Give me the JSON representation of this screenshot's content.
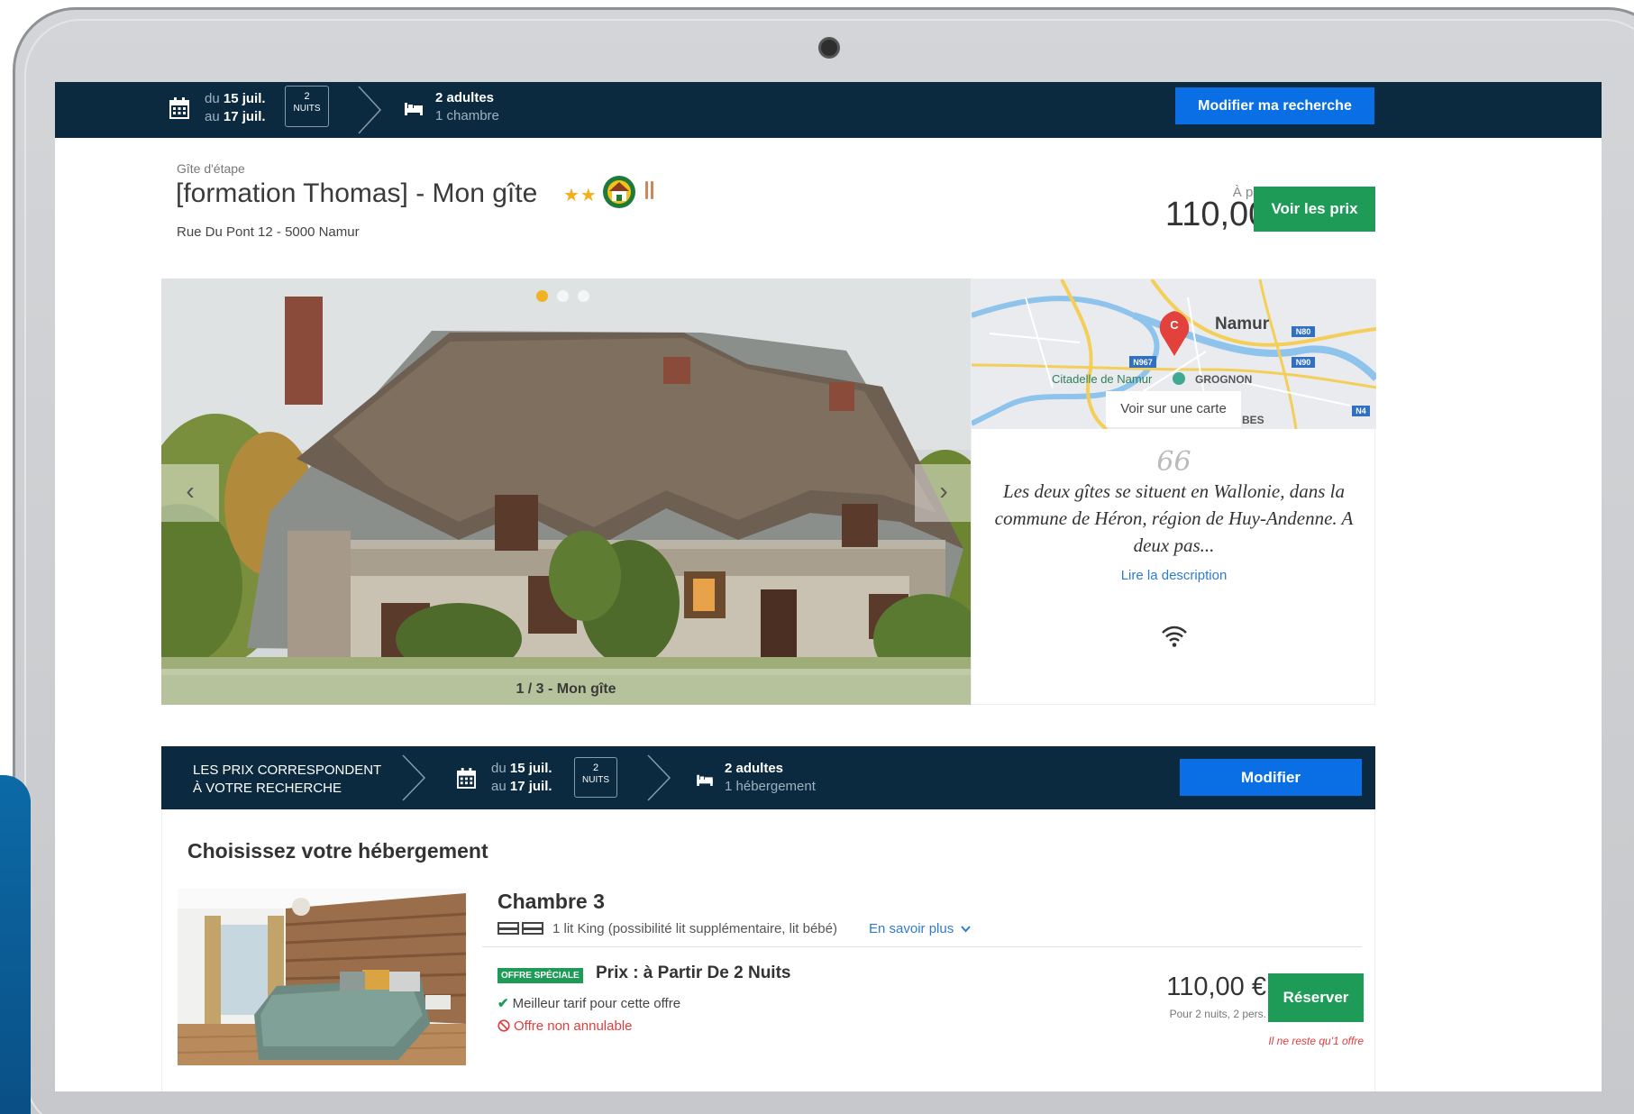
{
  "search_bar": {
    "from_label": "du",
    "from_date": "15 juil.",
    "to_label": "au",
    "to_date": "17 juil.",
    "nights_count": "2",
    "nights_label": "NUITS",
    "guests": "2 adultes",
    "rooms": "1 chambre",
    "modify_label": "Modifier ma recherche"
  },
  "property": {
    "category": "Gîte d'étape",
    "title": "[formation Thomas] - Mon gîte",
    "stars": "★★",
    "address": "Rue Du Pont 12 - 5000 Namur",
    "from_label": "À partir de",
    "price": "110,00 €",
    "see_prices_label": "Voir les prix"
  },
  "gallery": {
    "caption": "1 / 3 - Mon gîte",
    "current_index": 1,
    "total": 3,
    "prev_icon": "‹",
    "next_icon": "›"
  },
  "map": {
    "city": "Namur",
    "landmark": "Citadelle de Namur",
    "district": "GROGNON",
    "district2": "BES",
    "road_n80": "N80",
    "road_n90": "N90",
    "road_n967": "N967",
    "road_n4": "N4",
    "marker_letter": "C",
    "see_on_map_label": "Voir sur une carte"
  },
  "description": {
    "quote_mark": "66",
    "excerpt": "Les deux gîtes se situent en Wallonie, dans la commune de Héron, région de Huy-Andenne. A deux pas...",
    "read_more_label": "Lire la description"
  },
  "offers_bar": {
    "match_line1": "LES PRIX CORRESPONDENT",
    "match_line2": "À VOTRE RECHERCHE",
    "from_label": "du",
    "from_date": "15 juil.",
    "to_label": "au",
    "to_date": "17 juil.",
    "nights_count": "2",
    "nights_label": "NUITS",
    "guests": "2 adultes",
    "units": "1 hébergement",
    "modify_label": "Modifier"
  },
  "offers": {
    "heading": "Choisissez votre hébergement",
    "room": {
      "name": "Chambre 3",
      "beds": "1 lit King (possibilité lit supplémentaire, lit bébé)",
      "more_label": "En savoir plus",
      "offer": {
        "badge": "OFFRE SPÉCIALE",
        "title": "Prix : à Partir De 2 Nuits",
        "best_rate": "Meilleur tarif pour cette offre",
        "non_cancellable": "Offre non annulable",
        "price": "110,00 €",
        "price_detail": "Pour 2 nuits, 2 pers.",
        "book_label": "Réserver",
        "availability": "Il ne reste qu'1 offre"
      }
    }
  },
  "colors": {
    "navy": "#0b2a40",
    "primary_blue": "#0a6fe5",
    "green": "#1e9b57",
    "star_gold": "#f2b01e",
    "link_blue": "#2d7bd3",
    "alert_red": "#e23c3c"
  }
}
